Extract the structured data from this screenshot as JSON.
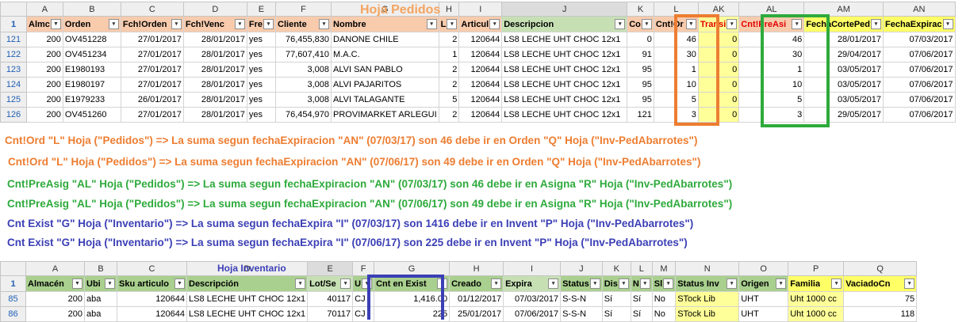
{
  "colors": {
    "orange": "#ED7D31",
    "green": "#2EAA3C",
    "blue": "#3B3FB5",
    "header_salmon": "#F8CBAD",
    "yellow": "#FFFF66",
    "light_yellow": "#FFFF99",
    "header_green": "#A9D08E",
    "header_ltgreen": "#C6E0B4"
  },
  "pedidos": {
    "title": "Hoja Pedidos",
    "col_letters": [
      "",
      "A",
      "B",
      "C",
      "D",
      "E",
      "F",
      "G",
      "H",
      "I",
      "J",
      "K",
      "L",
      "AK",
      "AL",
      "AM",
      "AN"
    ],
    "header_row_num": "1",
    "headers": [
      "Almc",
      "Orden",
      "Fch!Orden",
      "Fch!Venc",
      "Fre",
      "Cliente",
      "Nombre",
      "L",
      "Articul",
      "Descripcion",
      "Co",
      "Cnt!Or",
      "Transi",
      "Cnt!PreAsi",
      "FechaCortePed",
      "FechaExpirac"
    ],
    "rows": [
      {
        "n": "121",
        "cells": [
          "200",
          "OV451228",
          "27/01/2017",
          "28/01/2017",
          "yes",
          "76,455,830",
          "DANONE CHILE",
          "2",
          "120644",
          "LS8 LECHE UHT CHOC 12x1",
          "0",
          "46",
          "0",
          "46",
          "28/01/2017",
          "07/03/2017"
        ]
      },
      {
        "n": "122",
        "cells": [
          "200",
          "OV451234",
          "27/01/2017",
          "28/01/2017",
          "yes",
          "77,607,410",
          "M.A.C.",
          "1",
          "120644",
          "LS8 LECHE UHT CHOC 12x1",
          "91",
          "30",
          "0",
          "30",
          "29/04/2017",
          "07/06/2017"
        ]
      },
      {
        "n": "123",
        "cells": [
          "200",
          "E1980193",
          "27/01/2017",
          "28/01/2017",
          "yes",
          "3,008",
          "ALVI SAN PABLO",
          "2",
          "120644",
          "LS8 LECHE UHT CHOC 12x1",
          "95",
          "1",
          "0",
          "1",
          "03/05/2017",
          "07/06/2017"
        ]
      },
      {
        "n": "124",
        "cells": [
          "200",
          "E1980197",
          "27/01/2017",
          "28/01/2017",
          "yes",
          "3,008",
          "ALVI PAJARITOS",
          "2",
          "120644",
          "LS8 LECHE UHT CHOC 12x1",
          "95",
          "10",
          "0",
          "10",
          "03/05/2017",
          "07/06/2017"
        ]
      },
      {
        "n": "125",
        "cells": [
          "200",
          "E1979233",
          "26/01/2017",
          "28/01/2017",
          "yes",
          "3,008",
          "ALVI TALAGANTE",
          "5",
          "120644",
          "LS8 LECHE UHT CHOC 12x1",
          "95",
          "5",
          "0",
          "5",
          "03/05/2017",
          "07/06/2017"
        ]
      },
      {
        "n": "126",
        "cells": [
          "200",
          "OV451260",
          "27/01/2017",
          "28/01/2017",
          "yes",
          "76,454,970",
          "PROVIMARKET ARLEGUI",
          "2",
          "120644",
          "LS8 LECHE UHT CHOC 12x1",
          "121",
          "3",
          "0",
          "3",
          "29/05/2017",
          "07/06/2017"
        ]
      }
    ]
  },
  "notes": [
    "Cnt!Ord \"L\" Hoja (\"Pedidos\") => La suma segun fechaExpiracion \"AN\" (07/03/17) son 46 debe ir en Orden \"Q\" Hoja (\"Inv-PedAbarrotes\")",
    "Cnt!Ord \"L\" Hoja (\"Pedidos\") => La suma segun fechaExpiracion \"AN\" (07/06/17) son 49 debe ir en Orden \"Q\" Hoja (\"Inv-PedAbarrotes\")",
    "Cnt!PreAsig \"AL\" Hoja (\"Pedidos\") => La suma segun fechaExpiracion \"AN\" (07/03/17) son 46 debe ir en Asigna \"R\" Hoja (\"Inv-PedAbarrotes\")",
    "Cnt!PreAsig \"AL\" Hoja (\"Pedidos\") => La suma segun fechaExpiracion \"AN\" (07/06/17) son 49 debe ir en Asigna \"R\" Hoja (\"Inv-PedAbarrotes\")",
    "Cnt Exist \"G\" Hoja (\"Inventario\") => La suma segun fechaExpira \"I\" (07/03/17) son 1416 debe ir en Invent \"P\" Hoja (\"Inv-PedAbarrotes\")",
    "Cnt Exist \"G\" Hoja (\"Inventario\") => La suma segun fechaExpira \"I\" (07/06/17) son 225 debe ir en Invent \"P\" Hoja (\"Inv-PedAbarrotes\")"
  ],
  "inventario": {
    "title": "Hoja Inventario",
    "col_letters": [
      "",
      "A",
      "B",
      "C",
      "D",
      "E",
      "F",
      "G",
      "H",
      "I",
      "J",
      "K",
      "L",
      "M",
      "N",
      "O",
      "P",
      "Q"
    ],
    "header_row_num": "1",
    "headers": [
      "Almacén",
      "Ubi",
      "Sku articulo",
      "Descripción",
      "Lot/Se",
      "U",
      "Cnt en Exist",
      "Creado",
      "Expira",
      "Status",
      "Dis",
      "N",
      "Sl",
      "Status Inv",
      "Origen",
      "Familia",
      "VaciadoCn"
    ],
    "rows": [
      {
        "n": "85",
        "cells": [
          "200",
          "aba",
          "120644",
          "LS8 LECHE UHT CHOC 12x1",
          "40117",
          "CJ",
          "1,416.00",
          "01/12/2017",
          "07/03/2017",
          "S-S-N",
          "Sí",
          "Sí",
          "No",
          "STock Lib",
          "UHT",
          "Uht 1000 cc",
          "75"
        ]
      },
      {
        "n": "86",
        "cells": [
          "200",
          "aba",
          "120644",
          "LS8 LECHE UHT CHOC 12x1",
          "70117",
          "CJ",
          "225",
          "25/01/2017",
          "07/06/2017",
          "S-S-N",
          "Sí",
          "Sí",
          "No",
          "STock Lib",
          "UHT",
          "Uht 1000 cc",
          "118"
        ]
      }
    ]
  }
}
